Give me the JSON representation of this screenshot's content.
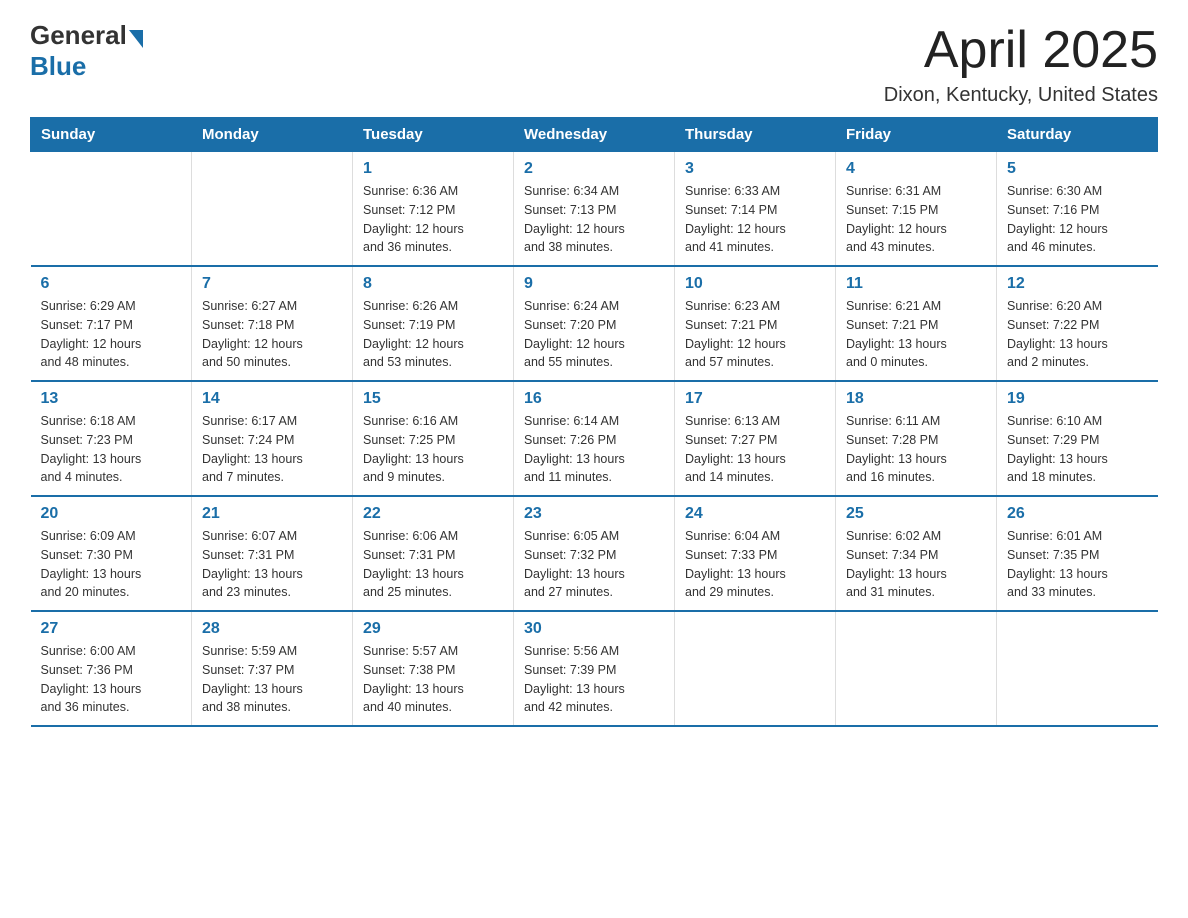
{
  "header": {
    "logo_general": "General",
    "logo_blue": "Blue",
    "title": "April 2025",
    "location": "Dixon, Kentucky, United States"
  },
  "days_of_week": [
    "Sunday",
    "Monday",
    "Tuesday",
    "Wednesday",
    "Thursday",
    "Friday",
    "Saturday"
  ],
  "weeks": [
    [
      {
        "day": "",
        "info": ""
      },
      {
        "day": "",
        "info": ""
      },
      {
        "day": "1",
        "info": "Sunrise: 6:36 AM\nSunset: 7:12 PM\nDaylight: 12 hours\nand 36 minutes."
      },
      {
        "day": "2",
        "info": "Sunrise: 6:34 AM\nSunset: 7:13 PM\nDaylight: 12 hours\nand 38 minutes."
      },
      {
        "day": "3",
        "info": "Sunrise: 6:33 AM\nSunset: 7:14 PM\nDaylight: 12 hours\nand 41 minutes."
      },
      {
        "day": "4",
        "info": "Sunrise: 6:31 AM\nSunset: 7:15 PM\nDaylight: 12 hours\nand 43 minutes."
      },
      {
        "day": "5",
        "info": "Sunrise: 6:30 AM\nSunset: 7:16 PM\nDaylight: 12 hours\nand 46 minutes."
      }
    ],
    [
      {
        "day": "6",
        "info": "Sunrise: 6:29 AM\nSunset: 7:17 PM\nDaylight: 12 hours\nand 48 minutes."
      },
      {
        "day": "7",
        "info": "Sunrise: 6:27 AM\nSunset: 7:18 PM\nDaylight: 12 hours\nand 50 minutes."
      },
      {
        "day": "8",
        "info": "Sunrise: 6:26 AM\nSunset: 7:19 PM\nDaylight: 12 hours\nand 53 minutes."
      },
      {
        "day": "9",
        "info": "Sunrise: 6:24 AM\nSunset: 7:20 PM\nDaylight: 12 hours\nand 55 minutes."
      },
      {
        "day": "10",
        "info": "Sunrise: 6:23 AM\nSunset: 7:21 PM\nDaylight: 12 hours\nand 57 minutes."
      },
      {
        "day": "11",
        "info": "Sunrise: 6:21 AM\nSunset: 7:21 PM\nDaylight: 13 hours\nand 0 minutes."
      },
      {
        "day": "12",
        "info": "Sunrise: 6:20 AM\nSunset: 7:22 PM\nDaylight: 13 hours\nand 2 minutes."
      }
    ],
    [
      {
        "day": "13",
        "info": "Sunrise: 6:18 AM\nSunset: 7:23 PM\nDaylight: 13 hours\nand 4 minutes."
      },
      {
        "day": "14",
        "info": "Sunrise: 6:17 AM\nSunset: 7:24 PM\nDaylight: 13 hours\nand 7 minutes."
      },
      {
        "day": "15",
        "info": "Sunrise: 6:16 AM\nSunset: 7:25 PM\nDaylight: 13 hours\nand 9 minutes."
      },
      {
        "day": "16",
        "info": "Sunrise: 6:14 AM\nSunset: 7:26 PM\nDaylight: 13 hours\nand 11 minutes."
      },
      {
        "day": "17",
        "info": "Sunrise: 6:13 AM\nSunset: 7:27 PM\nDaylight: 13 hours\nand 14 minutes."
      },
      {
        "day": "18",
        "info": "Sunrise: 6:11 AM\nSunset: 7:28 PM\nDaylight: 13 hours\nand 16 minutes."
      },
      {
        "day": "19",
        "info": "Sunrise: 6:10 AM\nSunset: 7:29 PM\nDaylight: 13 hours\nand 18 minutes."
      }
    ],
    [
      {
        "day": "20",
        "info": "Sunrise: 6:09 AM\nSunset: 7:30 PM\nDaylight: 13 hours\nand 20 minutes."
      },
      {
        "day": "21",
        "info": "Sunrise: 6:07 AM\nSunset: 7:31 PM\nDaylight: 13 hours\nand 23 minutes."
      },
      {
        "day": "22",
        "info": "Sunrise: 6:06 AM\nSunset: 7:31 PM\nDaylight: 13 hours\nand 25 minutes."
      },
      {
        "day": "23",
        "info": "Sunrise: 6:05 AM\nSunset: 7:32 PM\nDaylight: 13 hours\nand 27 minutes."
      },
      {
        "day": "24",
        "info": "Sunrise: 6:04 AM\nSunset: 7:33 PM\nDaylight: 13 hours\nand 29 minutes."
      },
      {
        "day": "25",
        "info": "Sunrise: 6:02 AM\nSunset: 7:34 PM\nDaylight: 13 hours\nand 31 minutes."
      },
      {
        "day": "26",
        "info": "Sunrise: 6:01 AM\nSunset: 7:35 PM\nDaylight: 13 hours\nand 33 minutes."
      }
    ],
    [
      {
        "day": "27",
        "info": "Sunrise: 6:00 AM\nSunset: 7:36 PM\nDaylight: 13 hours\nand 36 minutes."
      },
      {
        "day": "28",
        "info": "Sunrise: 5:59 AM\nSunset: 7:37 PM\nDaylight: 13 hours\nand 38 minutes."
      },
      {
        "day": "29",
        "info": "Sunrise: 5:57 AM\nSunset: 7:38 PM\nDaylight: 13 hours\nand 40 minutes."
      },
      {
        "day": "30",
        "info": "Sunrise: 5:56 AM\nSunset: 7:39 PM\nDaylight: 13 hours\nand 42 minutes."
      },
      {
        "day": "",
        "info": ""
      },
      {
        "day": "",
        "info": ""
      },
      {
        "day": "",
        "info": ""
      }
    ]
  ]
}
